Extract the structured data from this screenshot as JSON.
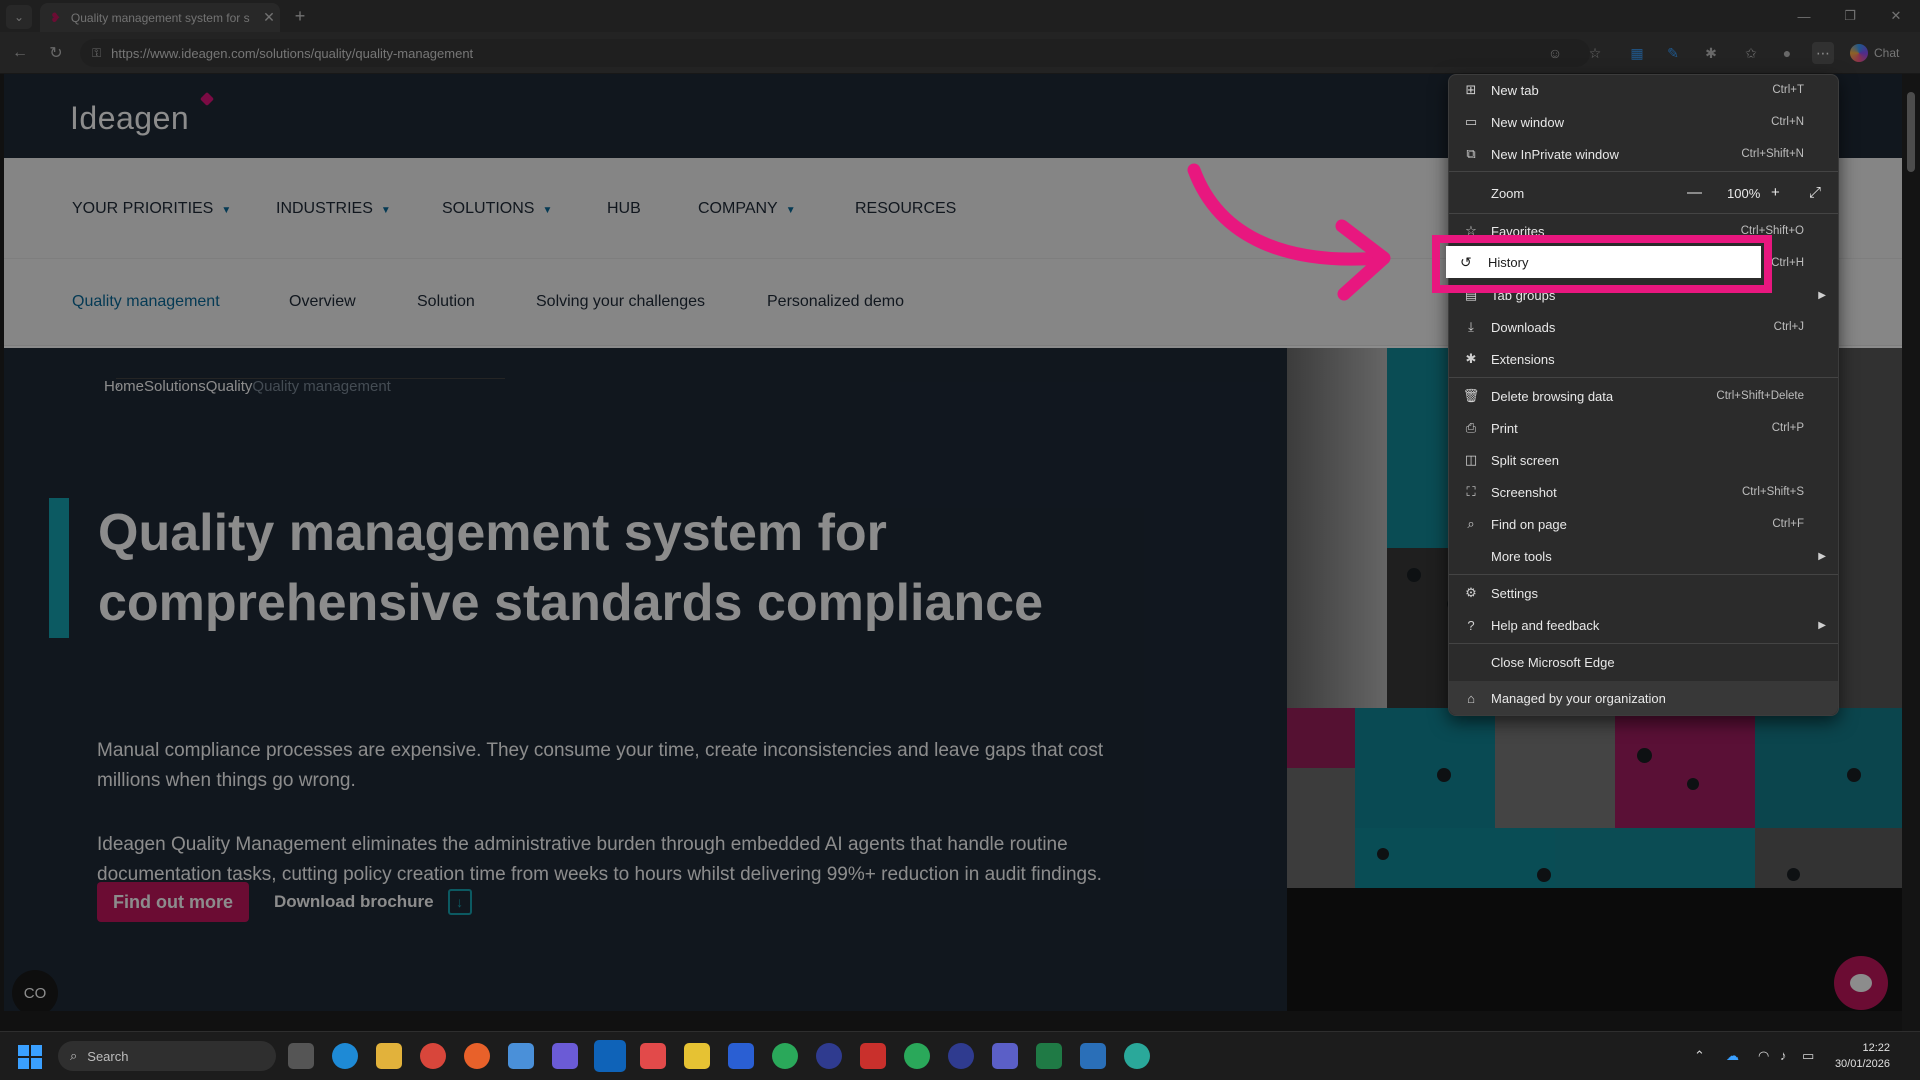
{
  "browser": {
    "tab_title": "Quality management system for s",
    "tab_close": "✕",
    "new_tab": "+",
    "url": "https://www.ideagen.com/solutions/quality/quality-management",
    "chat_label": "Chat"
  },
  "site": {
    "logo": "Ideagen",
    "nav": [
      "YOUR PRIORITIES",
      "INDUSTRIES",
      "SOLUTIONS",
      "HUB",
      "COMPANY",
      "RESOURCES"
    ],
    "subnav": [
      "Quality management",
      "Overview",
      "Solution",
      "Solving your challenges",
      "Personalized demo"
    ],
    "breadcrumb": [
      "Home",
      "Solutions",
      "Quality",
      "Quality management"
    ],
    "hero_title": "Quality management system for comprehensive standards compliance",
    "hero_p1": "Manual compliance processes are expensive. They consume your time, create inconsistencies and leave gaps that cost millions when things go wrong.",
    "hero_p2": "Ideagen Quality Management eliminates the administrative burden through embedded AI agents that handle routine documentation tasks, cutting policy creation time from weeks to hours whilst delivering 99%+ reduction in audit findings.",
    "cta_primary": "Find out more",
    "cta_secondary": "Download brochure"
  },
  "menu": {
    "new_tab": {
      "label": "New tab",
      "shortcut": "Ctrl+T"
    },
    "new_window": {
      "label": "New window",
      "shortcut": "Ctrl+N"
    },
    "inprivate": {
      "label": "New InPrivate window",
      "shortcut": "Ctrl+Shift+N"
    },
    "zoom": {
      "label": "Zoom",
      "value": "100%",
      "minus": "—",
      "plus": "+"
    },
    "favorites": {
      "label": "Favorites",
      "shortcut": "Ctrl+Shift+O"
    },
    "history": {
      "label": "History",
      "shortcut": "Ctrl+H"
    },
    "tab_groups": {
      "label": "Tab groups"
    },
    "downloads": {
      "label": "Downloads",
      "shortcut": "Ctrl+J"
    },
    "extensions": {
      "label": "Extensions"
    },
    "delete_data": {
      "label": "Delete browsing data",
      "shortcut": "Ctrl+Shift+Delete"
    },
    "print": {
      "label": "Print",
      "shortcut": "Ctrl+P"
    },
    "split": {
      "label": "Split screen"
    },
    "screenshot": {
      "label": "Screenshot",
      "shortcut": "Ctrl+Shift+S"
    },
    "find": {
      "label": "Find on page",
      "shortcut": "Ctrl+F"
    },
    "more_tools": {
      "label": "More tools"
    },
    "settings": {
      "label": "Settings"
    },
    "help": {
      "label": "Help and feedback"
    },
    "close_edge": {
      "label": "Close Microsoft Edge"
    },
    "managed": {
      "label": "Managed by your organization"
    }
  },
  "taskbar": {
    "search_placeholder": "Search",
    "time": "12:22",
    "date": "30/01/2026"
  },
  "colors": {
    "accent_pink": "#e8177f",
    "brand_teal": "#17a5b3",
    "brand_navy": "#1f2a38"
  }
}
